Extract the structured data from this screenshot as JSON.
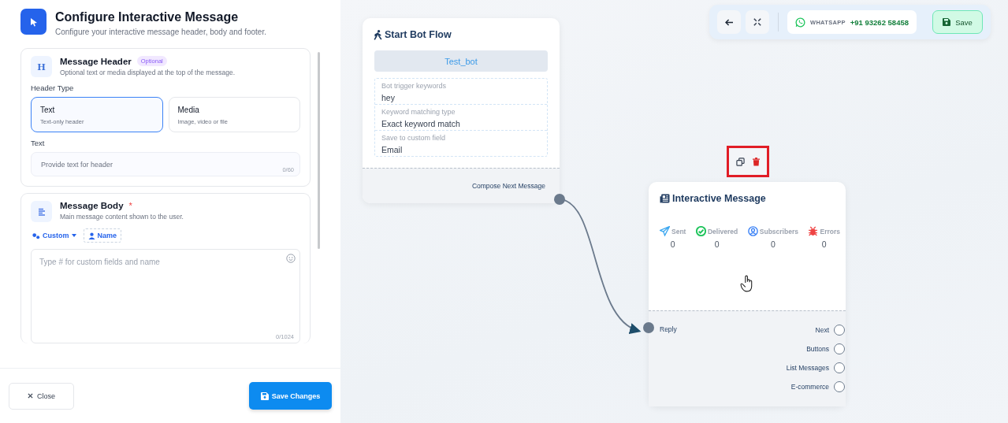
{
  "panel": {
    "title": "Configure Interactive Message",
    "subtitle": "Configure your interactive message header, body and footer.",
    "header_section": {
      "icon_letter": "H",
      "title": "Message Header",
      "badge": "Optional",
      "description": "Optional text or media displayed at the top of the message.",
      "type_label": "Header Type",
      "types": [
        {
          "label": "Text",
          "hint": "Text-only header",
          "selected": true
        },
        {
          "label": "Media",
          "hint": "Image, video or file",
          "selected": false
        }
      ],
      "text_label": "Text",
      "text_placeholder": "Provide text for header",
      "text_counter": "0/60"
    },
    "body_section": {
      "title": "Message Body",
      "required_mark": "*",
      "description": "Main message content shown to the user.",
      "custom_button": "Custom",
      "name_button": "Name",
      "placeholder": "Type # for custom fields and name",
      "counter": "0/1024"
    },
    "close_button": "Close",
    "save_button": "Save Changes"
  },
  "toolbar": {
    "channel": "WHATSAPP",
    "phone": "+91 93262 58458",
    "save_button": "Save"
  },
  "start_node": {
    "title": "Start Bot Flow",
    "bot_name": "Test_bot",
    "fields": [
      {
        "label": "Bot trigger keywords",
        "value": "hey"
      },
      {
        "label": "Keyword matching type",
        "value": "Exact keyword match"
      },
      {
        "label": "Save to custom field",
        "value": "Email"
      }
    ],
    "output": {
      "label": "Compose Next Message",
      "connected": true
    }
  },
  "message_node": {
    "title": "Interactive Message",
    "highlighted": true,
    "stats": [
      {
        "kind": "sent",
        "label": "Sent",
        "value": "0",
        "color": "#3ba7f0"
      },
      {
        "kind": "delivered",
        "label": "Delivered",
        "value": "0",
        "color": "#22c55e"
      },
      {
        "kind": "subscribers",
        "label": "Subscribers",
        "value": "0",
        "color": "#3b82f6"
      },
      {
        "kind": "errors",
        "label": "Errors",
        "value": "0",
        "color": "#ef4444"
      }
    ],
    "input": {
      "label": "Reply",
      "connected": true
    },
    "outputs": [
      {
        "label": "Next",
        "connected": false
      },
      {
        "label": "Buttons",
        "connected": false
      },
      {
        "label": "List Messages",
        "connected": false
      },
      {
        "label": "E-commerce",
        "connected": false
      }
    ]
  }
}
